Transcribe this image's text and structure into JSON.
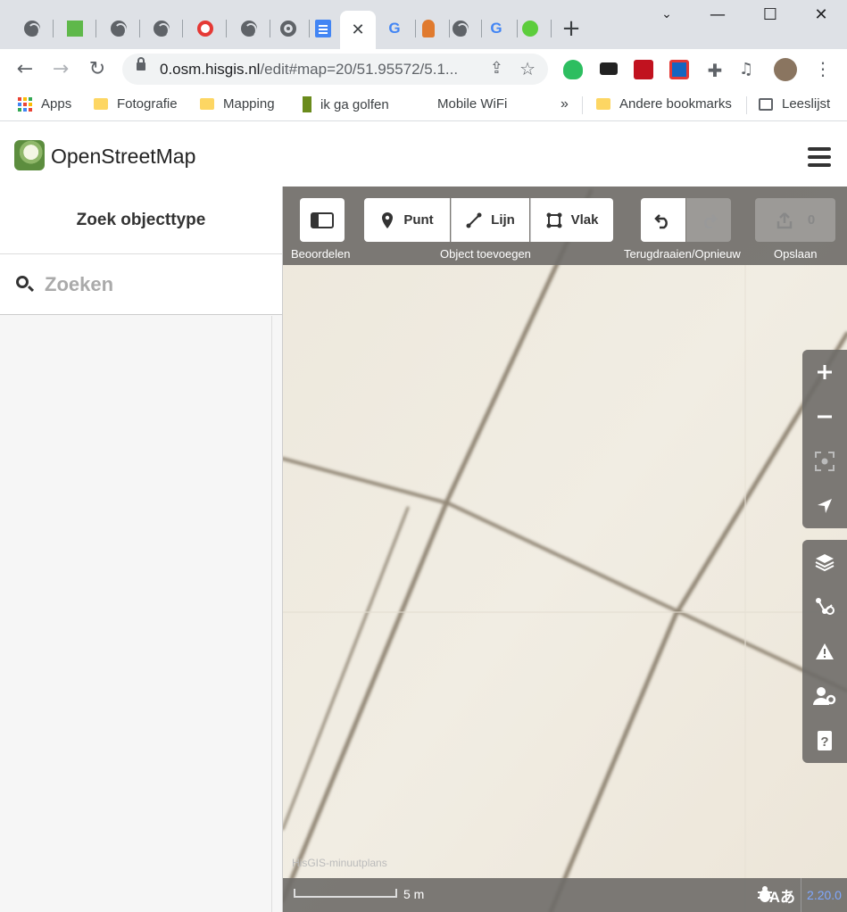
{
  "browser": {
    "tabs": [
      {
        "icon": "globe-icon"
      },
      {
        "icon": "green-square-icon"
      },
      {
        "icon": "globe-icon"
      },
      {
        "icon": "globe-icon"
      },
      {
        "icon": "red-circle-icon"
      },
      {
        "icon": "globe-icon"
      },
      {
        "icon": "chrome-icon"
      },
      {
        "icon": "docs-icon"
      },
      {
        "icon": "close-icon",
        "active": true
      },
      {
        "icon": "google-icon"
      },
      {
        "icon": "flag-icon"
      },
      {
        "icon": "globe-icon"
      },
      {
        "icon": "google-icon"
      },
      {
        "icon": "green-circle-icon"
      }
    ],
    "new_tab": "+",
    "url_host": "0.osm.hisgis.nl",
    "url_rest": "/edit#map=20/51.95572/5.1...",
    "bookmarks": {
      "apps": "Apps",
      "fotografie": "Fotografie",
      "mapping": "Mapping",
      "golfen": "ik ga golfen",
      "wifi": "Mobile WiFi",
      "more": "»",
      "other": "Andere bookmarks",
      "reading": "Leeslijst"
    }
  },
  "osm": {
    "title": "OpenStreetMap",
    "sidebar": {
      "heading": "Zoek objecttype",
      "search_placeholder": "Zoeken"
    },
    "toolbar": {
      "assess_label": "Beoordelen",
      "point": "Punt",
      "line": "Lijn",
      "area": "Vlak",
      "add_label": "Object toevoegen",
      "undo_redo_label": "Terugdraaien/Opnieuw",
      "save_count": "0",
      "save_label": "Opslaan"
    },
    "map": {
      "attribution": "HisGIS-minuutplans",
      "scale": "5 m",
      "version": "2.20.0"
    },
    "colors": {
      "map_bg": "#efeae0",
      "toolbar_bg": "#6e6c68",
      "line_color": "#6b5f4e"
    }
  }
}
